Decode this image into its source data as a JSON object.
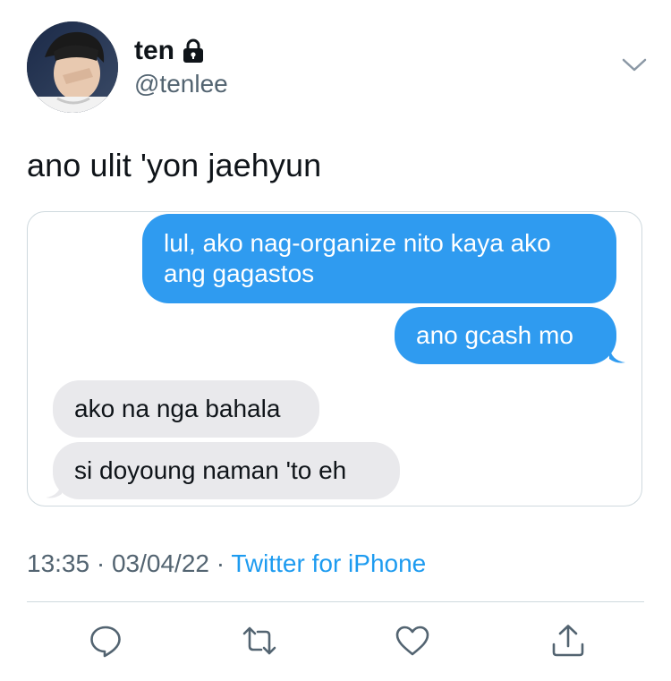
{
  "user": {
    "display_name": "ten",
    "handle": "@tenlee",
    "avatar_icon": "profile-avatar",
    "protected_icon": "lock-icon"
  },
  "tweet": {
    "text": "ano ulit 'yon jaehyun"
  },
  "messages": [
    {
      "side": "sent",
      "text": "lul, ako nag-organize nito kaya ako ang gagastos"
    },
    {
      "side": "sent",
      "text": "ano gcash mo"
    },
    {
      "side": "received",
      "text": "ako na nga bahala"
    },
    {
      "side": "received",
      "text": "si doyoung naman 'to eh"
    }
  ],
  "meta": {
    "time": "13:35",
    "sep1": " · ",
    "date": "03/04/22",
    "sep2": " · ",
    "source": "Twitter for iPhone"
  },
  "actions": [
    "reply-icon",
    "retweet-icon",
    "like-icon",
    "share-icon"
  ],
  "colors": {
    "sent_bubble": "#2f9bf0",
    "received_bubble": "#e9e9ec",
    "link": "#1d9bf0",
    "secondary_text": "#536471"
  }
}
